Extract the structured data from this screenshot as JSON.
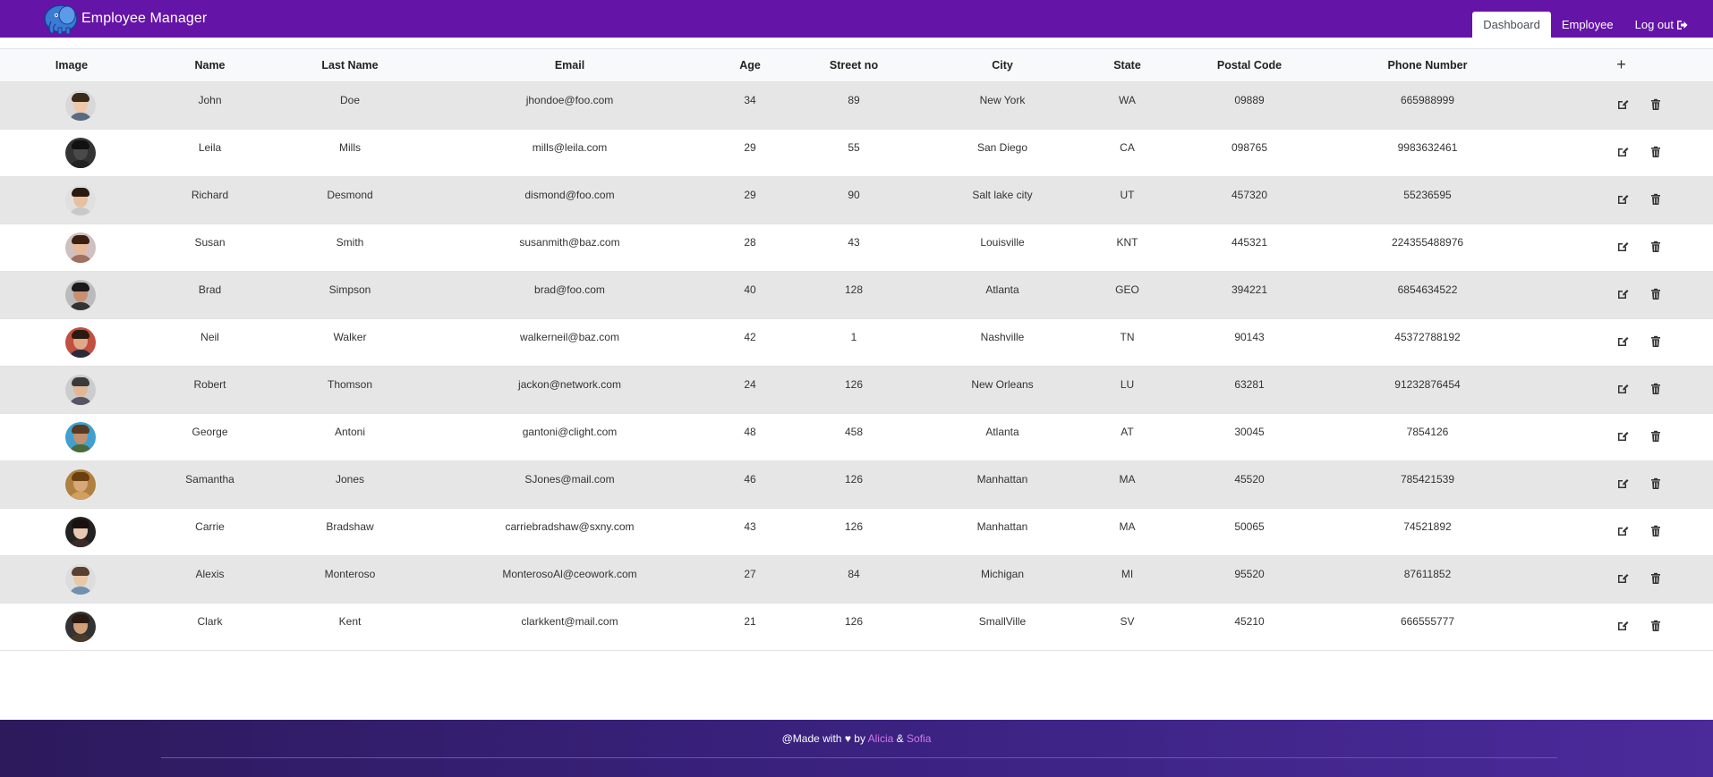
{
  "navbar": {
    "brand": "Employee Manager",
    "links": [
      "Dashboard",
      "Employee",
      "Log out"
    ],
    "colors": {
      "background": "#6514a8"
    }
  },
  "table": {
    "headers": [
      "Image",
      "Name",
      "Last Name",
      "Email",
      "Age",
      "Street no",
      "City",
      "State",
      "Postal Code",
      "Phone Number",
      "+"
    ],
    "rows": [
      {
        "name": "John",
        "last_name": "Doe",
        "email": "jhondoe@foo.com",
        "age": "34",
        "street_no": "89",
        "city": "New York",
        "state": "WA",
        "postal_code": "09889",
        "phone": "665988999"
      },
      {
        "name": "Leila",
        "last_name": "Mills",
        "email": "mills@leila.com",
        "age": "29",
        "street_no": "55",
        "city": "San Diego",
        "state": "CA",
        "postal_code": "098765",
        "phone": "9983632461"
      },
      {
        "name": "Richard",
        "last_name": "Desmond",
        "email": "dismond@foo.com",
        "age": "29",
        "street_no": "90",
        "city": "Salt lake city",
        "state": "UT",
        "postal_code": "457320",
        "phone": "55236595"
      },
      {
        "name": "Susan",
        "last_name": "Smith",
        "email": "susanmith@baz.com",
        "age": "28",
        "street_no": "43",
        "city": "Louisville",
        "state": "KNT",
        "postal_code": "445321",
        "phone": "224355488976"
      },
      {
        "name": "Brad",
        "last_name": "Simpson",
        "email": "brad@foo.com",
        "age": "40",
        "street_no": "128",
        "city": "Atlanta",
        "state": "GEO",
        "postal_code": "394221",
        "phone": "6854634522"
      },
      {
        "name": "Neil",
        "last_name": "Walker",
        "email": "walkerneil@baz.com",
        "age": "42",
        "street_no": "1",
        "city": "Nashville",
        "state": "TN",
        "postal_code": "90143",
        "phone": "45372788192"
      },
      {
        "name": "Robert",
        "last_name": "Thomson",
        "email": "jackon@network.com",
        "age": "24",
        "street_no": "126",
        "city": "New Orleans",
        "state": "LU",
        "postal_code": "63281",
        "phone": "91232876454"
      },
      {
        "name": "George",
        "last_name": "Antoni",
        "email": "gantoni@clight.com",
        "age": "48",
        "street_no": "458",
        "city": "Atlanta",
        "state": "AT",
        "postal_code": "30045",
        "phone": "7854126"
      },
      {
        "name": "Samantha",
        "last_name": "Jones",
        "email": "SJones@mail.com",
        "age": "46",
        "street_no": "126",
        "city": "Manhattan",
        "state": "MA",
        "postal_code": "45520",
        "phone": "785421539"
      },
      {
        "name": "Carrie",
        "last_name": "Bradshaw",
        "email": "carriebradshaw@sxny.com",
        "age": "43",
        "street_no": "126",
        "city": "Manhattan",
        "state": "MA",
        "postal_code": "50065",
        "phone": "74521892"
      },
      {
        "name": "Alexis",
        "last_name": "Monteroso",
        "email": "MonterosoAl@ceowork.com",
        "age": "27",
        "street_no": "84",
        "city": "Michigan",
        "state": "MI",
        "postal_code": "95520",
        "phone": "87611852"
      },
      {
        "name": "Clark",
        "last_name": "Kent",
        "email": "clarkkent@mail.com",
        "age": "21",
        "street_no": "126",
        "city": "SmallVille",
        "state": "SV",
        "postal_code": "45210",
        "phone": "666555777"
      }
    ],
    "colors": {
      "odd_row": "#e6e6e6",
      "even_row": "#ffffff"
    }
  },
  "footer": {
    "prefix": "@Made with",
    "heart": "♥",
    "by": "by",
    "author1": "Alicia",
    "amp": "&",
    "author2": "Sofia",
    "colors": {
      "link": "#d277e8"
    }
  }
}
